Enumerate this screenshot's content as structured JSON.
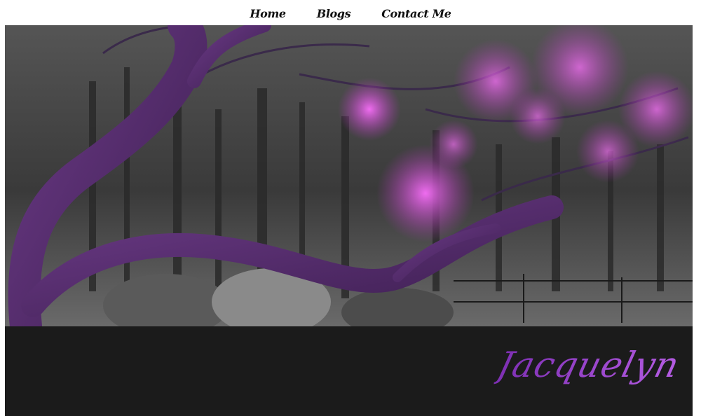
{
  "nav": {
    "items": [
      {
        "label": "Home"
      },
      {
        "label": "Blogs"
      },
      {
        "label": "Contact Me"
      }
    ]
  },
  "hero": {
    "image": "photo-redbud-tree-purple-blossoms-selective-color",
    "colors": {
      "trunk": "#5b2d6e",
      "blossom": "#d04bd8",
      "background": "#4a4a4a"
    }
  },
  "footer": {
    "signature": "Jacquelyn",
    "background": "#1b1b1b",
    "signature_color": "#a24bd6"
  }
}
